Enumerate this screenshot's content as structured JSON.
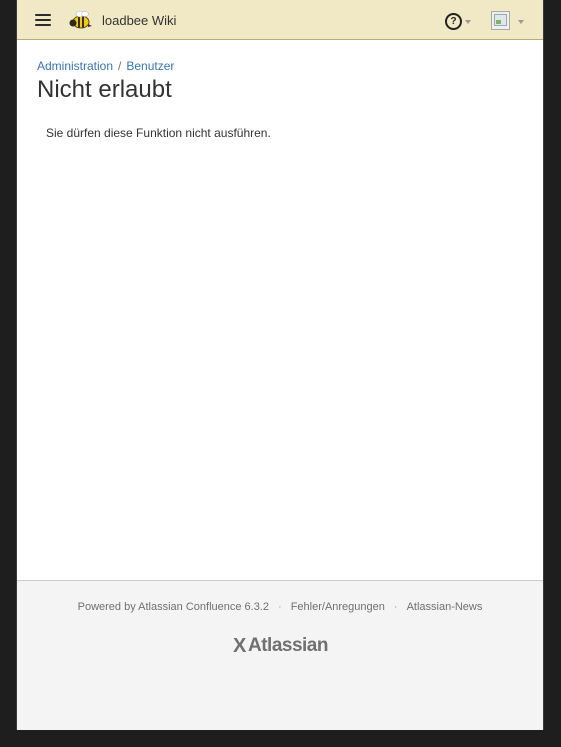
{
  "header": {
    "site_title": "loadbee Wiki",
    "help_icon": "question-circle-icon",
    "menu_icon": "hamburger-menu-icon",
    "avatar_icon": "broken-image-icon",
    "background_color": "#f1e8c5"
  },
  "breadcrumb": {
    "items": [
      "Administration",
      "Benutzer"
    ],
    "separator": "/"
  },
  "page": {
    "title": "Nicht erlaubt",
    "message": "Sie dürfen diese Funktion nicht ausführen."
  },
  "footer": {
    "powered_by": "Powered by Atlassian Confluence 6.3.2",
    "separator": "·",
    "report_link": "Fehler/Anregungen",
    "news_link": "Atlassian-News",
    "logo_text": "Atlassian",
    "logo_mark": "X"
  },
  "colors": {
    "link": "#3b73af",
    "text": "#333333",
    "footer_bg": "#f4f4f4"
  }
}
